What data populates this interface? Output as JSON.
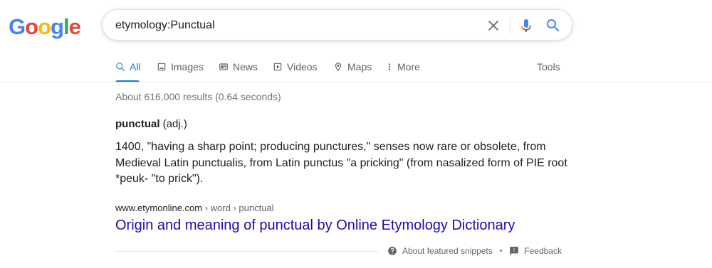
{
  "logo": {
    "letters": [
      "G",
      "o",
      "o",
      "g",
      "l",
      "e"
    ],
    "colors": [
      "#4285f4",
      "#ea4335",
      "#fbbc05",
      "#4285f4",
      "#34a853",
      "#ea4335"
    ]
  },
  "search": {
    "query": "etymology:Punctual"
  },
  "tabs": [
    {
      "label": "All",
      "icon": "search-icon",
      "active": true
    },
    {
      "label": "Images",
      "icon": "image-icon"
    },
    {
      "label": "News",
      "icon": "newspaper-icon"
    },
    {
      "label": "Videos",
      "icon": "play-icon"
    },
    {
      "label": "Maps",
      "icon": "map-pin-icon"
    },
    {
      "label": "More",
      "icon": "more-vert-icon"
    }
  ],
  "tools_label": "Tools",
  "result_stats": "About 616,000 results (0.64 seconds)",
  "snippet": {
    "word": "punctual",
    "pos": "(adj.)",
    "definition": "1400, \"having a sharp point; producing punctures,\" senses now rare or obsolete, from Medieval Latin punctualis, from Latin punctus \"a pricking\" (from nasalized form of PIE root *peuk- \"to prick\").",
    "cite_domain": "www.etymonline.com",
    "cite_path": " › word › punctual",
    "title": "Origin and meaning of punctual by Online Etymology Dictionary"
  },
  "footer": {
    "about": "About featured snippets",
    "separator": "•",
    "feedback": "Feedback"
  },
  "colors": {
    "accent": "#1a73e8",
    "link": "#1a0dab",
    "mic_blue": "#4285f4",
    "mic_red": "#ea4335"
  }
}
